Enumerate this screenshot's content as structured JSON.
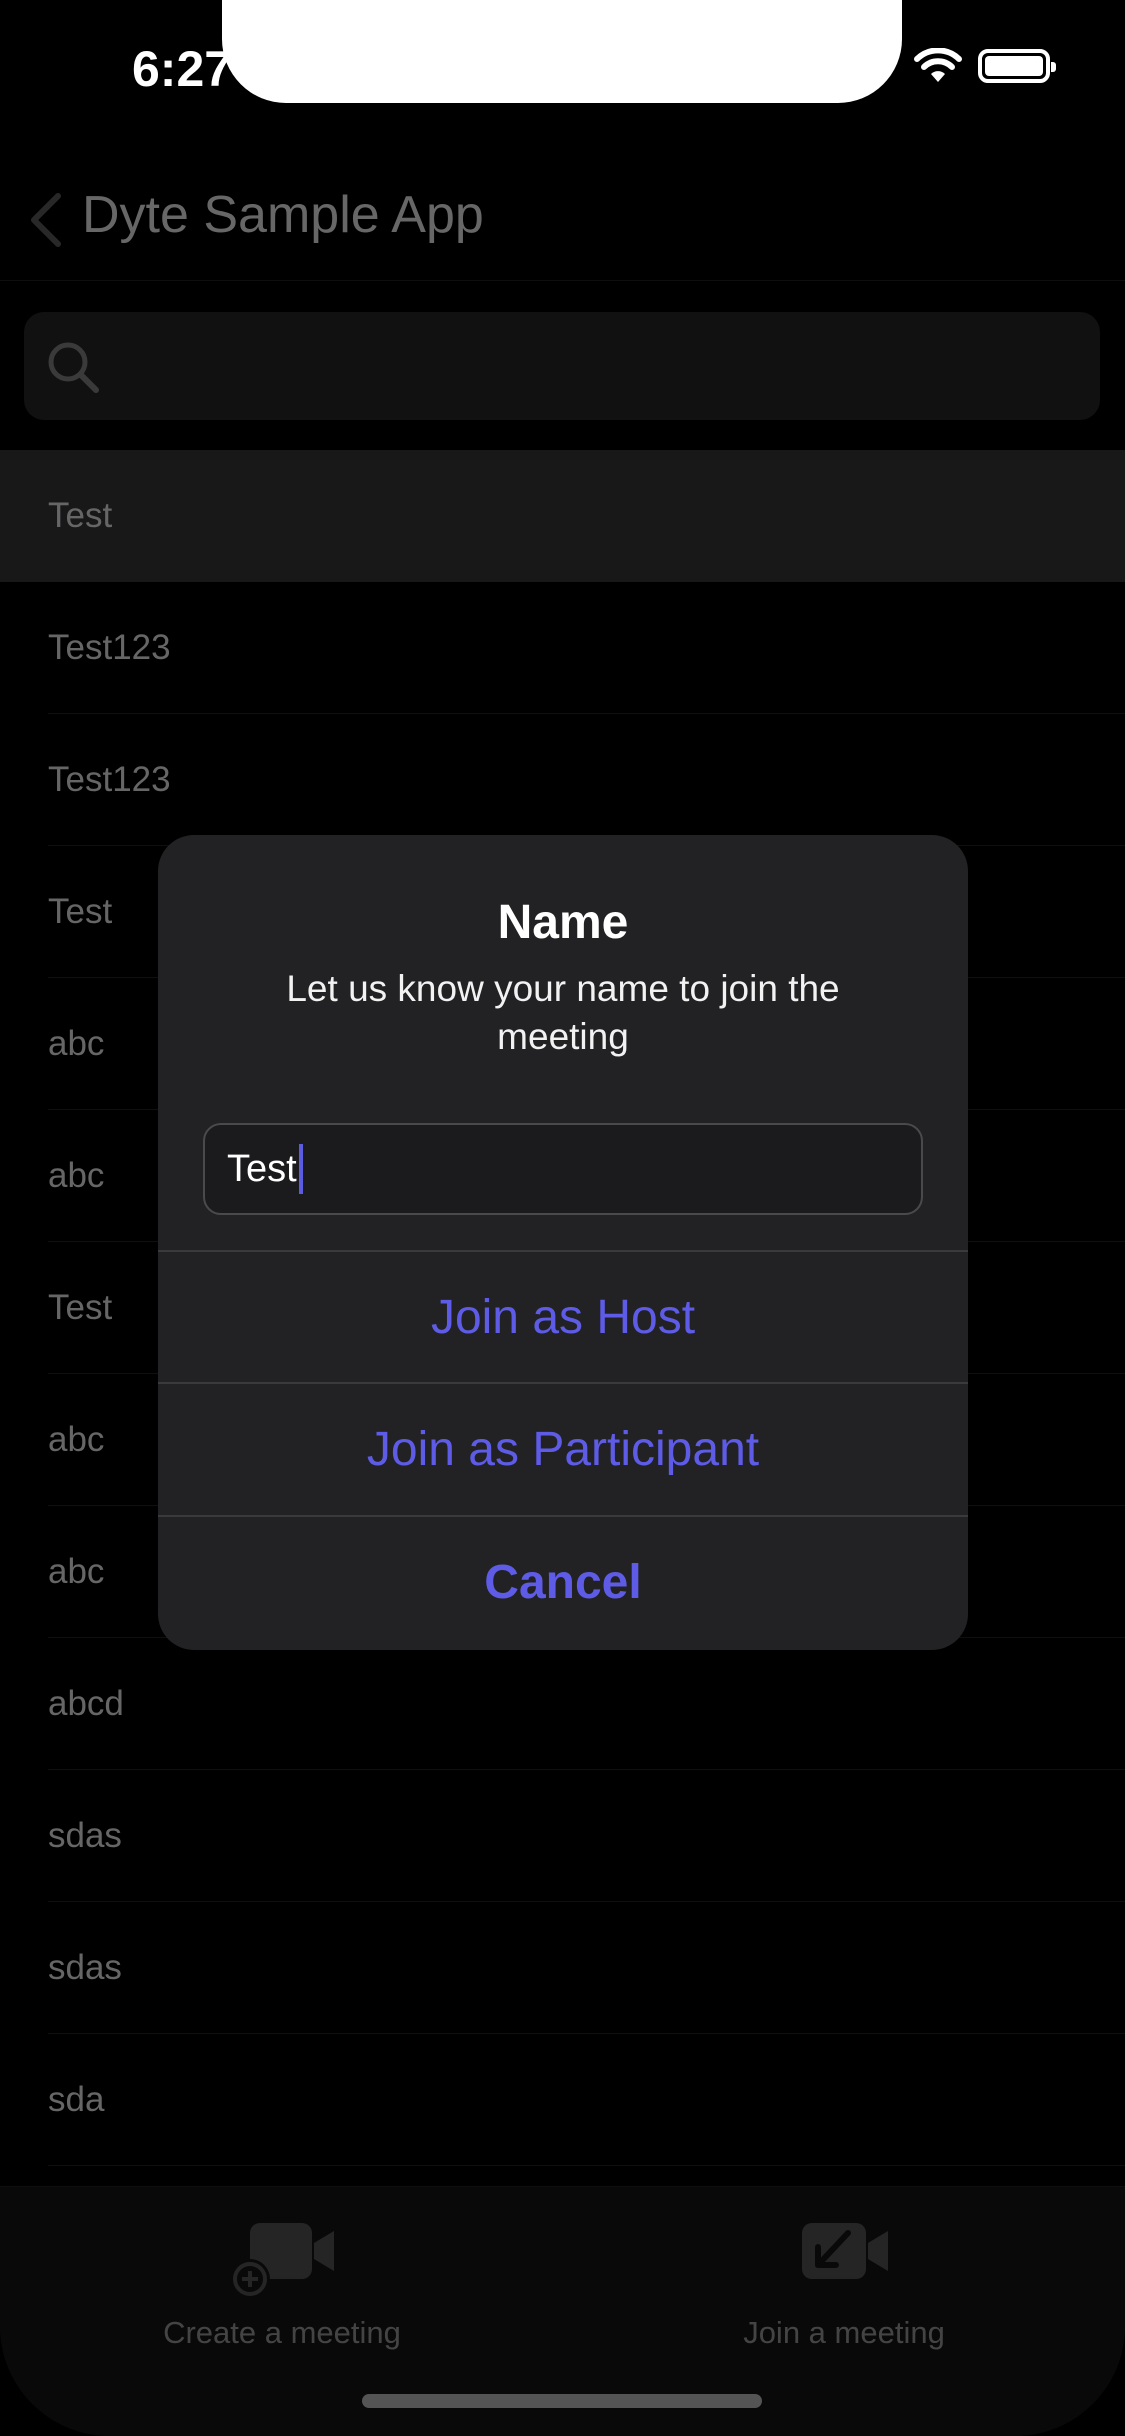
{
  "status_bar": {
    "time": "6:27"
  },
  "nav": {
    "back_label": "",
    "title": "Dyte Sample App"
  },
  "search": {
    "placeholder": ""
  },
  "list": {
    "items": [
      {
        "label": "Test",
        "highlighted": true
      },
      {
        "label": "Test123"
      },
      {
        "label": "Test123"
      },
      {
        "label": "Test"
      },
      {
        "label": "abc"
      },
      {
        "label": "abc"
      },
      {
        "label": "Test"
      },
      {
        "label": "abc"
      },
      {
        "label": "abc"
      },
      {
        "label": "abcd"
      },
      {
        "label": "sdas"
      },
      {
        "label": "sdas"
      },
      {
        "label": "sda"
      }
    ]
  },
  "tabbar": {
    "create_label": "Create a meeting",
    "join_label": "Join a meeting"
  },
  "alert": {
    "title": "Name",
    "message": "Let us know your name to join the meeting",
    "input_value": "Test",
    "host_button": "Join as Host",
    "participant_button": "Join as Participant",
    "cancel_button": "Cancel"
  },
  "colors": {
    "accent": "#5E5CE6",
    "background": "#000000",
    "alert_background": "#222224"
  }
}
